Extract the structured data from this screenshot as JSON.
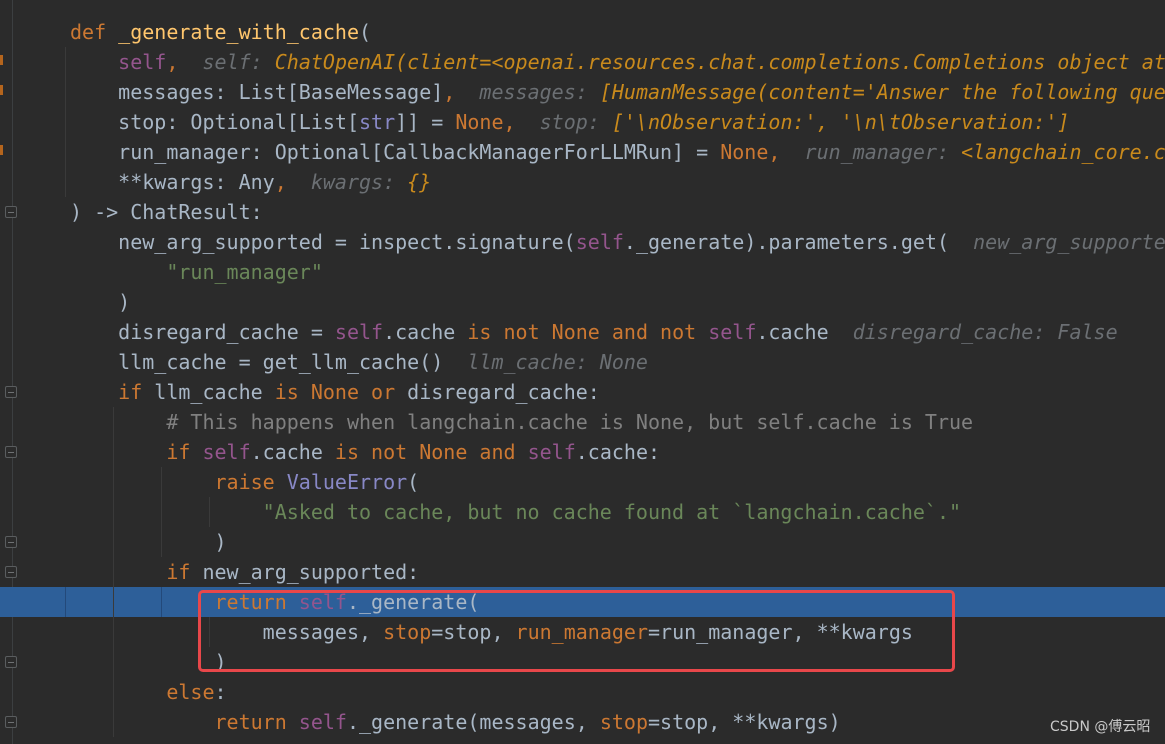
{
  "editor": {
    "colors": {
      "background": "#2b2b2b",
      "highlight": "#2d5f99",
      "keyword": "#cc7832",
      "string": "#6a8759",
      "self": "#94558d",
      "annotation_box": "#e8474a"
    },
    "highlighted_line": 20,
    "lines": [
      {
        "tokens": [
          [
            "kw",
            "def "
          ],
          [
            "fn",
            "_generate_with_cache"
          ],
          [
            "pl",
            "("
          ]
        ]
      },
      {
        "tokens": [
          [
            "pl",
            "    "
          ],
          [
            "self",
            "self"
          ],
          [
            "kw",
            ","
          ],
          [
            "pl",
            "  "
          ],
          [
            "hint",
            "self: "
          ],
          [
            "hv",
            "ChatOpenAI(client=<openai.resources.chat.completions.Completions object at"
          ]
        ]
      },
      {
        "tokens": [
          [
            "pl",
            "    messages: List[BaseMessage]"
          ],
          [
            "kw",
            ","
          ],
          [
            "pl",
            "  "
          ],
          [
            "hint",
            "messages: "
          ],
          [
            "hv",
            "[HumanMessage(content='Answer the following que"
          ]
        ]
      },
      {
        "tokens": [
          [
            "pl",
            "    stop: Optional[List["
          ],
          [
            "bi",
            "str"
          ],
          [
            "pl",
            "]] = "
          ],
          [
            "kw",
            "None,"
          ],
          [
            "pl",
            "  "
          ],
          [
            "hint",
            "stop: "
          ],
          [
            "hv",
            "['\\nObservation:', '\\n\\tObservation:']"
          ]
        ]
      },
      {
        "tokens": [
          [
            "pl",
            "    run_manager: Optional[CallbackManagerForLLMRun] = "
          ],
          [
            "kw",
            "None,"
          ],
          [
            "pl",
            "  "
          ],
          [
            "hint",
            "run_manager: "
          ],
          [
            "hv",
            "<langchain_core.c"
          ]
        ]
      },
      {
        "tokens": [
          [
            "pl",
            "    **kwargs: Any"
          ],
          [
            "kw",
            ","
          ],
          [
            "pl",
            "  "
          ],
          [
            "hint",
            "kwargs: "
          ],
          [
            "hv",
            "{}"
          ]
        ]
      },
      {
        "tokens": [
          [
            "pl",
            ") -> ChatResult:"
          ]
        ]
      },
      {
        "tokens": [
          [
            "pl",
            "    new_arg_supported = inspect.signature("
          ],
          [
            "self",
            "self"
          ],
          [
            "pl",
            "._generate).parameters.get(  "
          ],
          [
            "hint",
            "new_arg_supporte"
          ]
        ]
      },
      {
        "tokens": [
          [
            "pl",
            "        "
          ],
          [
            "str",
            "\"run_manager\""
          ]
        ]
      },
      {
        "tokens": [
          [
            "pl",
            "    )"
          ]
        ]
      },
      {
        "tokens": [
          [
            "pl",
            "    disregard_cache = "
          ],
          [
            "self",
            "self"
          ],
          [
            "pl",
            ".cache "
          ],
          [
            "kw",
            "is not None and not "
          ],
          [
            "self",
            "self"
          ],
          [
            "pl",
            ".cache  "
          ],
          [
            "hint",
            "disregard_cache: False"
          ]
        ]
      },
      {
        "tokens": [
          [
            "pl",
            "    llm_cache = get_llm_cache()  "
          ],
          [
            "hint",
            "llm_cache: None"
          ]
        ]
      },
      {
        "tokens": [
          [
            "kw",
            "    if "
          ],
          [
            "pl",
            "llm_cache "
          ],
          [
            "kw",
            "is None or "
          ],
          [
            "pl",
            "disregard_cache:"
          ]
        ]
      },
      {
        "tokens": [
          [
            "cm",
            "        # This happens when langchain.cache is None, but self.cache is True"
          ]
        ]
      },
      {
        "tokens": [
          [
            "kw",
            "        if "
          ],
          [
            "self",
            "self"
          ],
          [
            "pl",
            ".cache "
          ],
          [
            "kw",
            "is not None and "
          ],
          [
            "self",
            "self"
          ],
          [
            "pl",
            ".cache:"
          ]
        ]
      },
      {
        "tokens": [
          [
            "kw",
            "            raise "
          ],
          [
            "bi",
            "ValueError"
          ],
          [
            "pl",
            "("
          ]
        ]
      },
      {
        "tokens": [
          [
            "pl",
            "                "
          ],
          [
            "str",
            "\"Asked to cache, but no cache found at `langchain.cache`.\""
          ]
        ]
      },
      {
        "tokens": [
          [
            "pl",
            "            )"
          ]
        ]
      },
      {
        "tokens": [
          [
            "kw",
            "        if "
          ],
          [
            "pl",
            "new_arg_supported:"
          ]
        ]
      },
      {
        "tokens": [
          [
            "kw",
            "            return "
          ],
          [
            "self",
            "self"
          ],
          [
            "pl",
            "._generate("
          ]
        ]
      },
      {
        "tokens": [
          [
            "pl",
            "                messages, "
          ],
          [
            "kw",
            "stop"
          ],
          [
            "pl",
            "=stop, "
          ],
          [
            "kw",
            "run_manager"
          ],
          [
            "pl",
            "=run_manager, **kwargs"
          ]
        ]
      },
      {
        "tokens": [
          [
            "pl",
            "            )"
          ]
        ]
      },
      {
        "tokens": [
          [
            "kw",
            "        else"
          ],
          [
            "pl",
            ":"
          ]
        ]
      },
      {
        "tokens": [
          [
            "kw",
            "            return "
          ],
          [
            "self",
            "self"
          ],
          [
            "pl",
            "._generate(messages, "
          ],
          [
            "kw",
            "stop"
          ],
          [
            "pl",
            "=stop, **kwargs)"
          ]
        ]
      }
    ]
  },
  "watermark": "CSDN @傅云昭"
}
